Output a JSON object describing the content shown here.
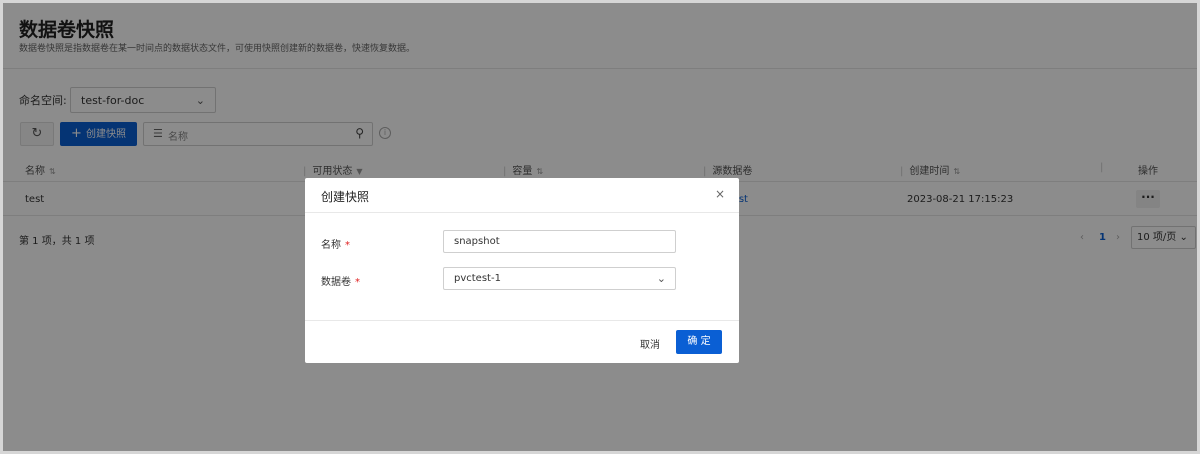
{
  "page": {
    "title": "数据卷快照",
    "description": "数据卷快照是指数据卷在某一时间点的数据状态文件，可使用快照创建新的数据卷，快速恢复数据。"
  },
  "namespace": {
    "label": "命名空间:",
    "value": "test-for-doc"
  },
  "toolbar": {
    "create_label": "创建快照",
    "filter_placeholder": "名称"
  },
  "table": {
    "columns": [
      "名称",
      "可用状态",
      "容量",
      "源数据卷",
      "创建时间",
      "操作"
    ],
    "rows": [
      {
        "name": "test",
        "source": "pvctest",
        "created": "2023-08-21 17:15:23",
        "action": "···"
      }
    ]
  },
  "pagination": {
    "summary": "第 1 项，共 1 项",
    "current_page": "1",
    "page_size": "10 项/页"
  },
  "modal": {
    "title": "创建快照",
    "name_label": "名称",
    "name_value": "snapshot",
    "volume_label": "数据卷",
    "volume_value": "pvctest-1",
    "cancel_label": "取消",
    "ok_label": "确 定"
  },
  "colors": {
    "primary": "#0a5fd4",
    "required": "#e02020",
    "overlay": "rgba(0,0,0,0.45)"
  }
}
